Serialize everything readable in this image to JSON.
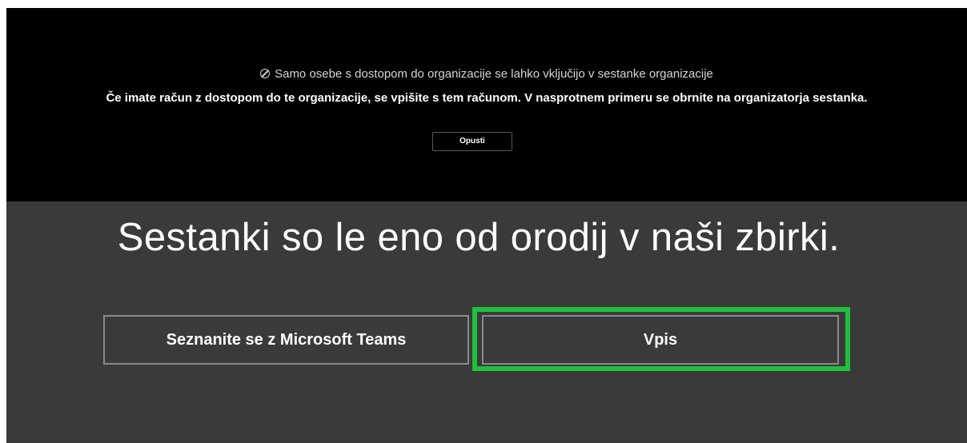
{
  "banner": {
    "notice_icon": "blocked-icon",
    "notice_text": "Samo osebe s dostopom do organizacije se lahko vključijo v sestanke organizacije",
    "instruction_text": "Če imate račun z dostopom do te organizacije, se vpišite s tem računom. V nasprotnem primeru se obrnite na organizatorja sestanka.",
    "dismiss_label": "Opusti"
  },
  "main": {
    "headline": "Sestanki so le eno od orodij v naši zbirki.",
    "learn_label": "Seznanite se z Microsoft Teams",
    "signin_label": "Vpis",
    "highlight_color": "#1fc13c"
  }
}
